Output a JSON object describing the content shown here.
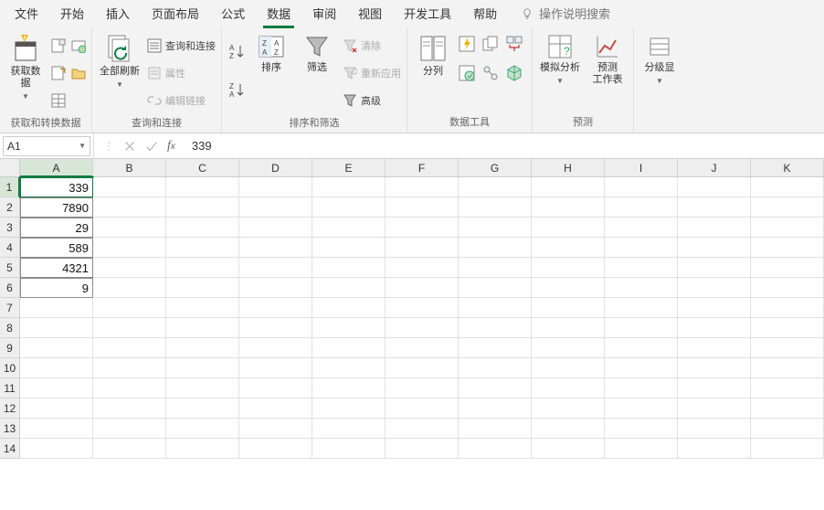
{
  "menu": {
    "items": [
      "文件",
      "开始",
      "插入",
      "页面布局",
      "公式",
      "数据",
      "审阅",
      "视图",
      "开发工具",
      "帮助"
    ],
    "active_index": 5,
    "tell_me": "操作说明搜索"
  },
  "ribbon": {
    "group1": {
      "btn": "获取数\n据",
      "label": "获取和转换数据"
    },
    "group2": {
      "btn": "全部刷新",
      "item1": "查询和连接",
      "item2": "属性",
      "item3": "编辑链接",
      "label": "查询和连接"
    },
    "group3": {
      "sort": "排序",
      "filter": "筛选",
      "clear": "清除",
      "reapply": "重新应用",
      "advanced": "高级",
      "label": "排序和筛选"
    },
    "group4": {
      "btn": "分列",
      "label": "数据工具"
    },
    "group5": {
      "btn1": "模拟分析",
      "btn2": "预测\n工作表",
      "label": "预测"
    },
    "group6": {
      "btn": "分级显"
    }
  },
  "formula": {
    "name_box": "A1",
    "value": "339"
  },
  "sheet": {
    "columns": [
      "A",
      "B",
      "C",
      "D",
      "E",
      "F",
      "G",
      "H",
      "I",
      "J",
      "K"
    ],
    "rows": [
      1,
      2,
      3,
      4,
      5,
      6,
      7,
      8,
      9,
      10,
      11,
      12,
      13,
      14
    ],
    "active": {
      "row": 1,
      "col": "A"
    },
    "data": {
      "A1": "339",
      "A2": "7890",
      "A3": "29",
      "A4": "589",
      "A5": "4321",
      "A6": "9"
    }
  }
}
